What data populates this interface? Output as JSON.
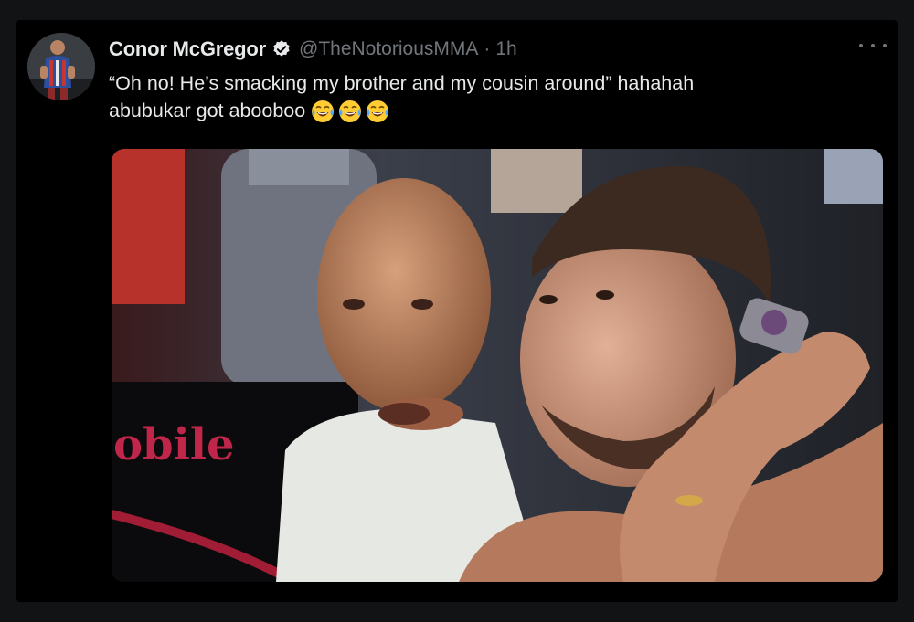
{
  "tweet": {
    "display_name": "Conor McGregor",
    "handle": "@TheNotoriousMMA",
    "separator": "·",
    "time": "1h",
    "text_line1": "“Oh no! He’s smacking my brother and my cousin around” hahahah",
    "text_line2": "abubukar got abooboo",
    "emojis": [
      "face-with-tears-of-joy",
      "face-with-tears-of-joy",
      "face-with-tears-of-joy"
    ],
    "media_text": "obile"
  },
  "colors": {
    "background": "#000000",
    "primary_text": "#e7e9ea",
    "secondary_text": "#71767b",
    "verified_badge": "#e7e9ea"
  },
  "icons": [
    "verified-icon",
    "more-options-icon"
  ]
}
